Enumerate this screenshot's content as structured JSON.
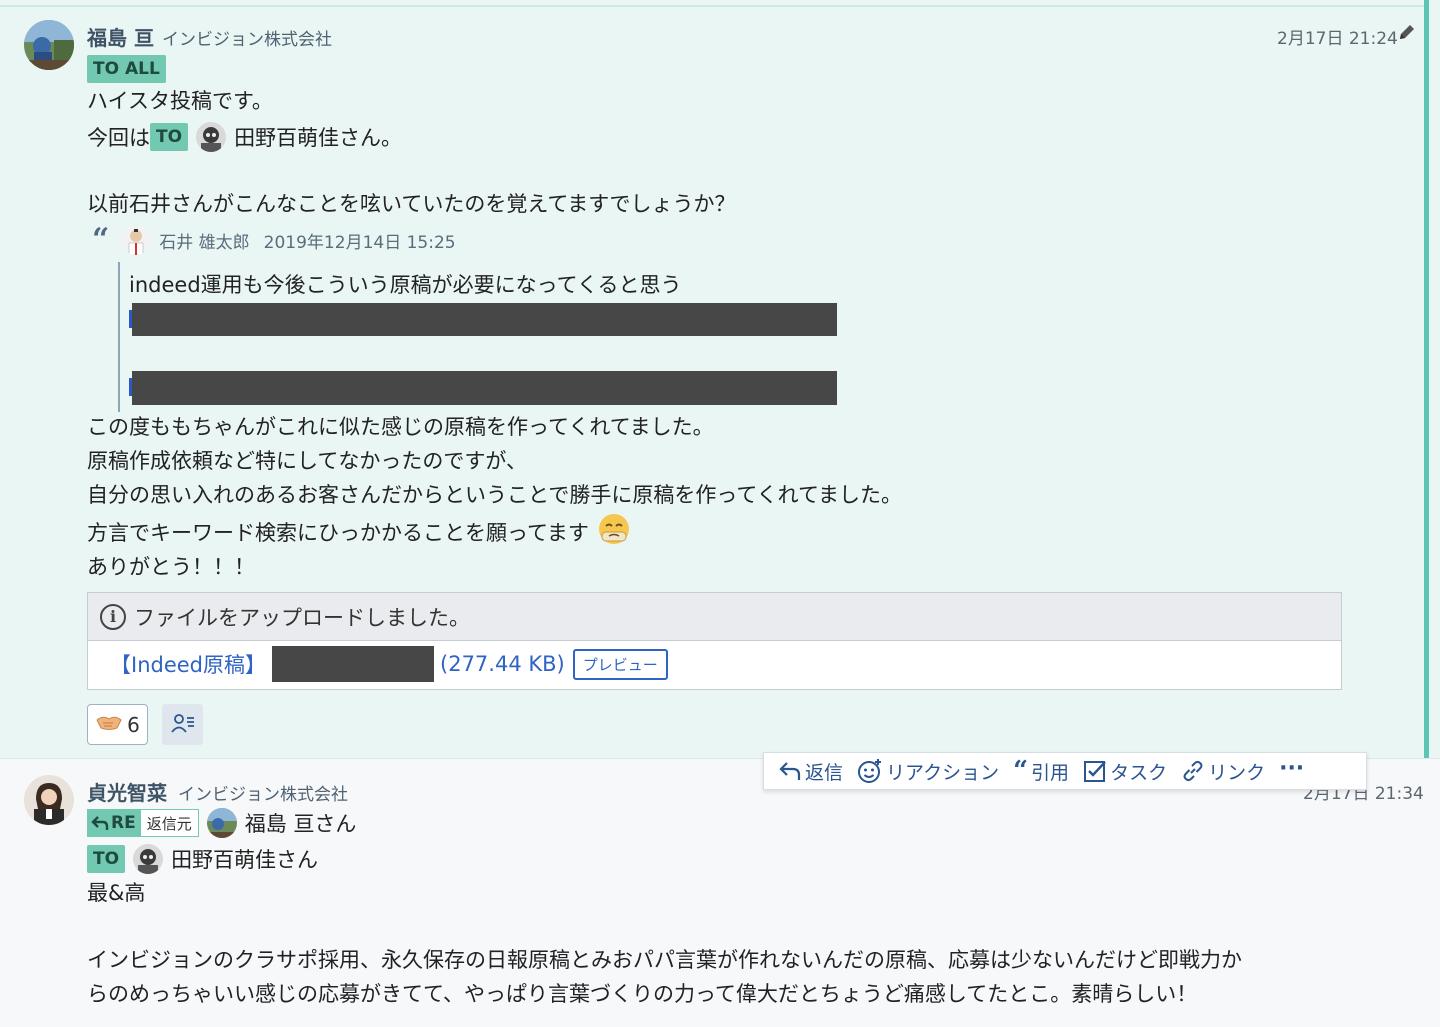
{
  "message1": {
    "sender_name": "福島 亘",
    "sender_org": "インビジョン株式会社",
    "timestamp": "2月17日 21:24",
    "to_all_label": "TO ALL",
    "to_label": "TO",
    "line1": "ハイスタ投稿です。",
    "line2_prefix": "今回は",
    "mention_name": "田野百萌佳さん。",
    "line3": "以前石井さんがこんなことを呟いていたのを覚えてますでしょうか？",
    "quote": {
      "author": "石井 雄太郎",
      "date": "2019年12月14日 15:25",
      "text": "indeed運用も今後こういう原稿が必要になってくると思う"
    },
    "line4": "この度ももちゃんがこれに似た感じの原稿を作ってくれてました。",
    "line5": "原稿作成依頼など特にしてなかったのですが、",
    "line6": "自分の思い入れのあるお客さんだからということで勝手に原稿を作ってくれてました。",
    "line7": "方言でキーワード検索にひっかかることを願ってます",
    "line8": "ありがとう！！！",
    "file": {
      "header": "ファイルをアップロードしました。",
      "name_prefix": "【Indeed原稿】",
      "size": "(277.44 KB)",
      "preview_label": "プレビュー"
    },
    "reaction_count": "6"
  },
  "action_bar": {
    "reply": "返信",
    "reaction": "リアクション",
    "quote": "引用",
    "task": "タスク",
    "link": "リンク",
    "more": "···"
  },
  "message2": {
    "sender_name": "貞光智菜",
    "sender_org": "インビジョン株式会社",
    "timestamp": "2月17日 21:34",
    "re_label": "RE",
    "re_source": "返信元",
    "re_name": "福島 亘さん",
    "to_label": "TO",
    "to_name": "田野百萌佳さん",
    "line1": "最&高",
    "line2": "インビジョンのクラサポ採用、永久保存の日報原稿とみおパパ言葉が作れないんだの原稿、応募は少ないんだけど即戦力か",
    "line3": "らのめっちゃいい感じの応募がきてて、やっぱり言葉づくりの力って偉大だとちょうど痛感してたとこ。素晴らしい！"
  },
  "colors": {
    "highlight_bg": "#eaf6f4",
    "accent_teal": "#72c8b0",
    "link_blue": "#2f63c4",
    "redaction": "#474747"
  },
  "icons": [
    "edit-pencil-icon",
    "info-icon",
    "reply-icon",
    "reaction-icon",
    "quote-icon",
    "task-icon",
    "link-icon",
    "more-icon",
    "handshake-icon",
    "reaction-users-icon",
    "worried-face-icon"
  ]
}
